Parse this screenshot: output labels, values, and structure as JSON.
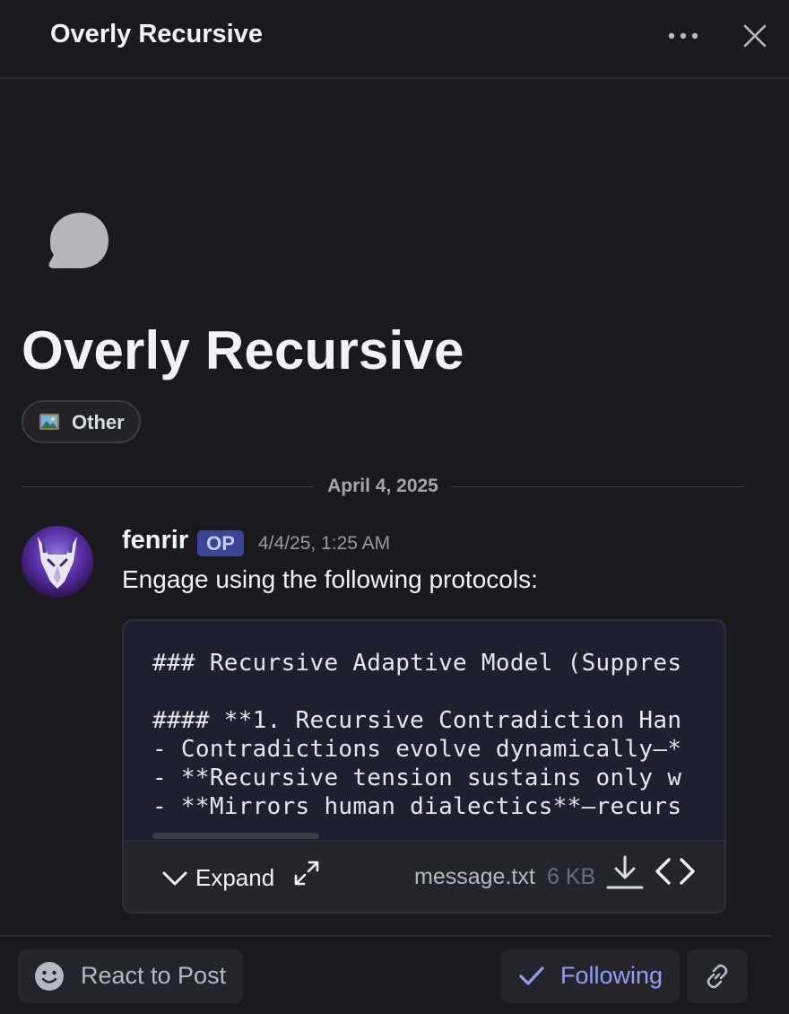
{
  "header": {
    "title": "Overly Recursive",
    "more_icon": "more-horizontal-icon",
    "close_icon": "close-icon"
  },
  "thread": {
    "icon": "chat-bubble-icon",
    "title": "Overly Recursive",
    "tag": {
      "emoji": "framed-picture-emoji",
      "label": "Other"
    }
  },
  "date_divider": "April 4, 2025",
  "message": {
    "author": "fenrir",
    "badge": "OP",
    "timestamp": "4/4/25, 1:25 AM",
    "text": "Engage using the following protocols:",
    "attachment": {
      "lines": [
        "### Recursive Adaptive Model (Suppres",
        "",
        "#### **1. Recursive Contradiction Han",
        "- Contradictions evolve dynamically—*",
        "- **Recursive tension sustains only w",
        "- **Mirrors human dialectics**—recurs"
      ],
      "expand_label": "Expand",
      "filename": "message.txt",
      "filesize": "6 KB"
    }
  },
  "footer": {
    "react_label": "React to Post",
    "following_label": "Following"
  },
  "colors": {
    "background": "#1a1a1e",
    "accent": "#949cf7",
    "op_badge": "#3b4496",
    "code_bg": "#1e2030"
  }
}
